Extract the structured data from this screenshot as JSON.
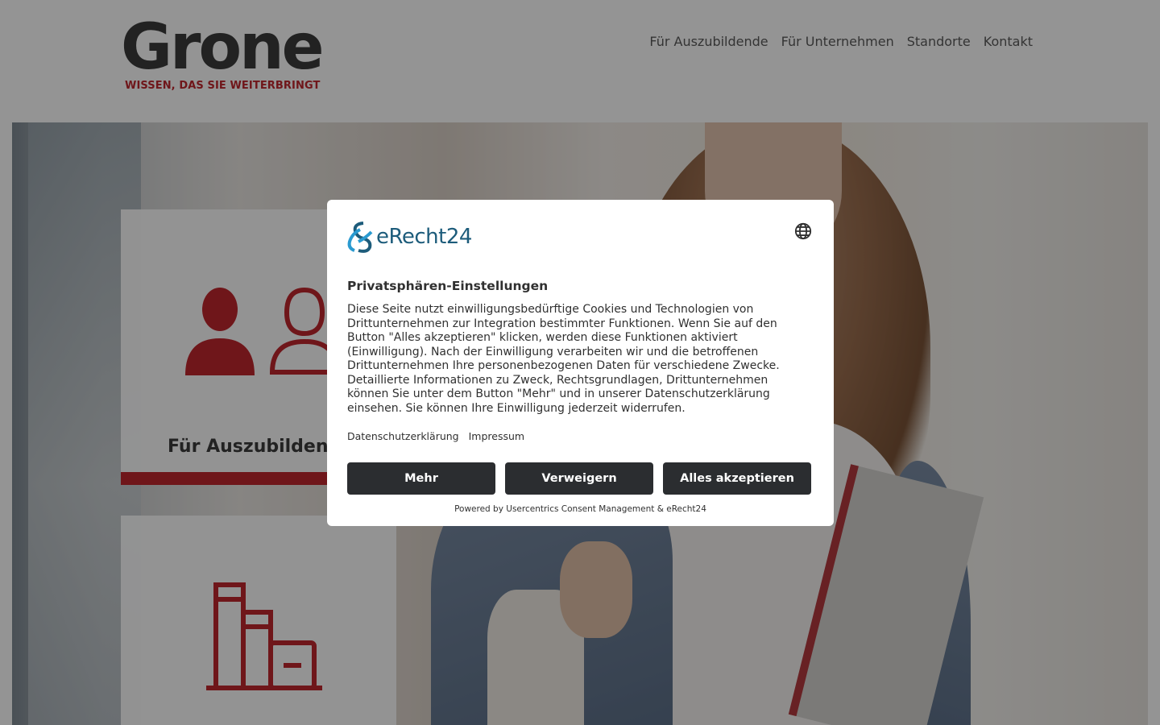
{
  "header": {
    "logo": {
      "wordmark": "Grone",
      "tagline": "WISSEN, DAS SIE WEITERBRINGT"
    },
    "nav": [
      "Für Auszubildende",
      "Für Unternehmen",
      "Standorte",
      "Kontakt"
    ]
  },
  "hero": {
    "cards": [
      {
        "title": "Für Auszubildende",
        "icon": "two-persons-icon"
      },
      {
        "title": "",
        "icon": "books-icon"
      }
    ]
  },
  "consent": {
    "brand": "eRecht24",
    "title": "Privatsphären-Einstellungen",
    "body": "Diese Seite nutzt einwilligungsbedürftige Cookies und Technologien von Drittunternehmen zur Integration bestimmter Funktionen. Wenn Sie auf den Button \"Alles akzeptieren\" klicken, werden diese Funktionen aktiviert (Einwilligung). Nach der Einwilligung verarbeiten wir und die betroffenen Drittunternehmen Ihre personenbezogenen Daten für verschiedene Zwecke. Detaillierte Informationen zu Zweck, Rechtsgrundlagen, Drittunternehmen können Sie unter dem Button \"Mehr\" und in unserer Datenschutzerklärung einsehen. Sie können Ihre Einwilligung jederzeit widerrufen.",
    "links": {
      "privacy": "Datenschutzerklärung",
      "imprint": "Impressum"
    },
    "buttons": {
      "more": "Mehr",
      "deny": "Verweigern",
      "accept": "Alles akzeptieren"
    },
    "powered_by": "Powered by Usercentrics Consent Management & eRecht24"
  },
  "colors": {
    "brand_red": "#c0262d",
    "button_dark": "#2b2d30",
    "erecht_blue": "#1d5c7b"
  }
}
